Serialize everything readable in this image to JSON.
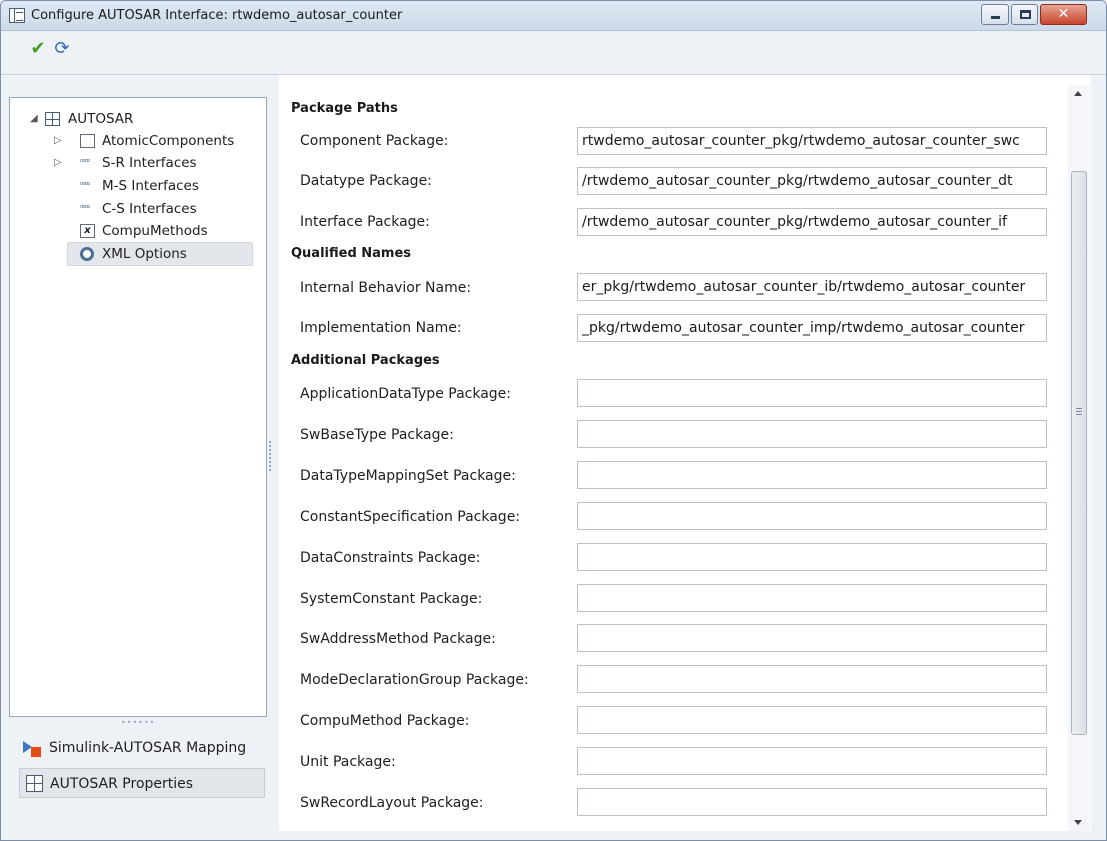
{
  "window": {
    "title": "Configure AUTOSAR Interface: rtwdemo_autosar_counter",
    "close_glyph": "✕"
  },
  "toolbar": {
    "apply_icon": "✔",
    "refresh_icon": "⟳"
  },
  "tree": {
    "root": {
      "label": "AUTOSAR",
      "icon": "grid-icon",
      "toggle": "◢"
    },
    "items": [
      {
        "label": "AtomicComponents",
        "icon": "box-icon",
        "toggle": "▷"
      },
      {
        "label": "S-R Interfaces",
        "icon": "interface-icon",
        "toggle": "▷"
      },
      {
        "label": "M-S Interfaces",
        "icon": "interface-icon",
        "toggle": ""
      },
      {
        "label": "C-S Interfaces",
        "icon": "interface-icon",
        "toggle": ""
      },
      {
        "label": "CompuMethods",
        "icon": "fx-icon",
        "toggle": ""
      },
      {
        "label": "XML Options",
        "icon": "gear-icon",
        "toggle": "",
        "selected": true
      }
    ],
    "interface_glyph": "ꟹꟹ",
    "fx_glyph": "x"
  },
  "splitter": {
    "dots": "••••••"
  },
  "nav": {
    "mapping": "Simulink-AUTOSAR Mapping",
    "properties": "AUTOSAR Properties"
  },
  "sections": {
    "package_paths": "Package Paths",
    "qualified_names": "Qualified Names",
    "additional_packages": "Additional Packages"
  },
  "fields": {
    "component_package": {
      "label": "Component Package:",
      "value": "rtwdemo_autosar_counter_pkg/rtwdemo_autosar_counter_swc"
    },
    "datatype_package": {
      "label": "Datatype Package:",
      "value": "/rtwdemo_autosar_counter_pkg/rtwdemo_autosar_counter_dt"
    },
    "interface_package": {
      "label": "Interface Package:",
      "value": "/rtwdemo_autosar_counter_pkg/rtwdemo_autosar_counter_if"
    },
    "internal_behavior_name": {
      "label": "Internal Behavior Name:",
      "value": "er_pkg/rtwdemo_autosar_counter_ib/rtwdemo_autosar_counter"
    },
    "implementation_name": {
      "label": "Implementation Name:",
      "value": "_pkg/rtwdemo_autosar_counter_imp/rtwdemo_autosar_counter"
    },
    "application_data_type_package": {
      "label": "ApplicationDataType Package:",
      "value": ""
    },
    "sw_base_type_package": {
      "label": "SwBaseType Package:",
      "value": ""
    },
    "data_type_mapping_set_package": {
      "label": "DataTypeMappingSet Package:",
      "value": ""
    },
    "constant_specification_package": {
      "label": "ConstantSpecification Package:",
      "value": ""
    },
    "data_constraints_package": {
      "label": "DataConstraints Package:",
      "value": ""
    },
    "system_constant_package": {
      "label": "SystemConstant Package:",
      "value": ""
    },
    "sw_address_method_package": {
      "label": "SwAddressMethod Package:",
      "value": ""
    },
    "mode_declaration_group_package": {
      "label": "ModeDeclarationGroup Package:",
      "value": ""
    },
    "compu_method_package": {
      "label": "CompuMethod Package:",
      "value": ""
    },
    "unit_package": {
      "label": "Unit Package:",
      "value": ""
    },
    "sw_record_layout_package": {
      "label": "SwRecordLayout Package:",
      "value": ""
    }
  }
}
